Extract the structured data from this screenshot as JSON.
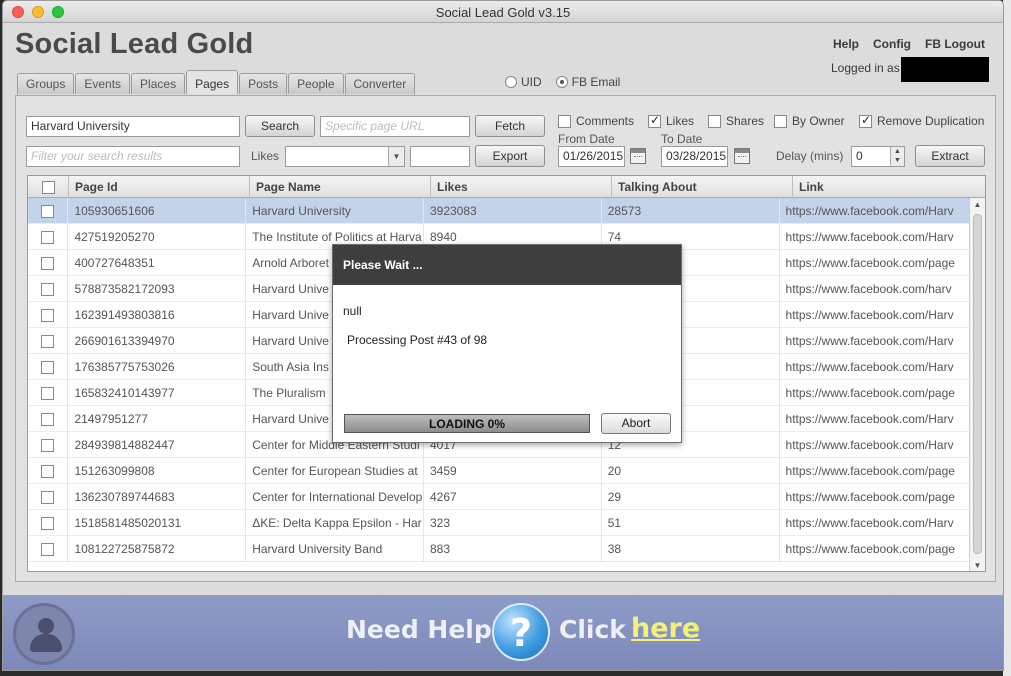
{
  "window": {
    "title": "Social Lead Gold v3.15"
  },
  "app": {
    "title": "Social Lead Gold"
  },
  "top_links": {
    "help": "Help",
    "config": "Config",
    "logout": "FB Logout",
    "logged_in": "Logged in as"
  },
  "tabs": [
    {
      "label": "Groups"
    },
    {
      "label": "Events"
    },
    {
      "label": "Places"
    },
    {
      "label": "Pages",
      "active": true
    },
    {
      "label": "Posts"
    },
    {
      "label": "People"
    },
    {
      "label": "Converter"
    }
  ],
  "radio": {
    "uid": "UID",
    "fb_email": "FB Email",
    "selected": "fb_email"
  },
  "search": {
    "value": "Harvard University",
    "search_button": "Search",
    "url_placeholder": "Specific page URL",
    "fetch_button": "Fetch",
    "filter_placeholder": "Filter your search results",
    "likes_label": "Likes",
    "export_button": "Export"
  },
  "options": {
    "comments": "Comments",
    "comments_checked": false,
    "likes": "Likes",
    "likes_checked": true,
    "shares": "Shares",
    "shares_checked": false,
    "by_owner": "By Owner",
    "by_owner_checked": false,
    "remove_dup": "Remove Duplication",
    "remove_dup_checked": true
  },
  "dates": {
    "from_label": "From Date",
    "from_value": "01/26/2015",
    "to_label": "To Date",
    "to_value": "03/28/2015"
  },
  "delay": {
    "label": "Delay (mins)",
    "value": "0"
  },
  "extract_button": "Extract",
  "table": {
    "headers": [
      "Page Id",
      "Page Name",
      "Likes",
      "Talking About",
      "Link"
    ],
    "rows": [
      [
        "105930651606",
        "Harvard University",
        "3923083",
        "28573",
        "https://www.facebook.com/Harv"
      ],
      [
        "427519205270",
        "The Institute of Politics at Harva",
        "8940",
        "74",
        "https://www.facebook.com/Harv"
      ],
      [
        "400727648351",
        "Arnold Arboret",
        "",
        "",
        "https://www.facebook.com/page"
      ],
      [
        "578873582172093",
        "Harvard Unive",
        "",
        "",
        "https://www.facebook.com/harv"
      ],
      [
        "162391493803816",
        "Harvard Unive",
        "",
        "",
        "https://www.facebook.com/Harv"
      ],
      [
        "266901613394970",
        "Harvard Unive",
        "",
        "",
        "https://www.facebook.com/Harv"
      ],
      [
        "176385775753026",
        "South Asia Ins",
        "",
        "",
        "https://www.facebook.com/Harv"
      ],
      [
        "165832410143977",
        "The Pluralism",
        "",
        "",
        "https://www.facebook.com/page"
      ],
      [
        "21497951277",
        "Harvard Unive",
        "",
        "",
        "https://www.facebook.com/Harv"
      ],
      [
        "284939814882447",
        "Center for Middle Eastern Studi",
        "4017",
        "12",
        "https://www.facebook.com/Harv"
      ],
      [
        "151263099808",
        "Center for European Studies at",
        "3459",
        "20",
        "https://www.facebook.com/page"
      ],
      [
        "136230789744683",
        "Center for International Develop",
        "4267",
        "29",
        "https://www.facebook.com/page"
      ],
      [
        "1518581485020131",
        "ΔKE: Delta Kappa Epsilon - Har",
        "323",
        "51",
        "https://www.facebook.com/Harv"
      ],
      [
        "108122725875872",
        "Harvard University Band",
        "883",
        "38",
        "https://www.facebook.com/page"
      ]
    ]
  },
  "modal": {
    "title": "Please Wait ...",
    "null_text": "null",
    "status": "Processing Post #43 of 98",
    "progress_text": "LOADING 0%",
    "progress_value": 0,
    "abort_button": "Abort"
  },
  "footer": {
    "need_help": "Need Help?",
    "question": "?",
    "click": "Click",
    "here": "here"
  }
}
